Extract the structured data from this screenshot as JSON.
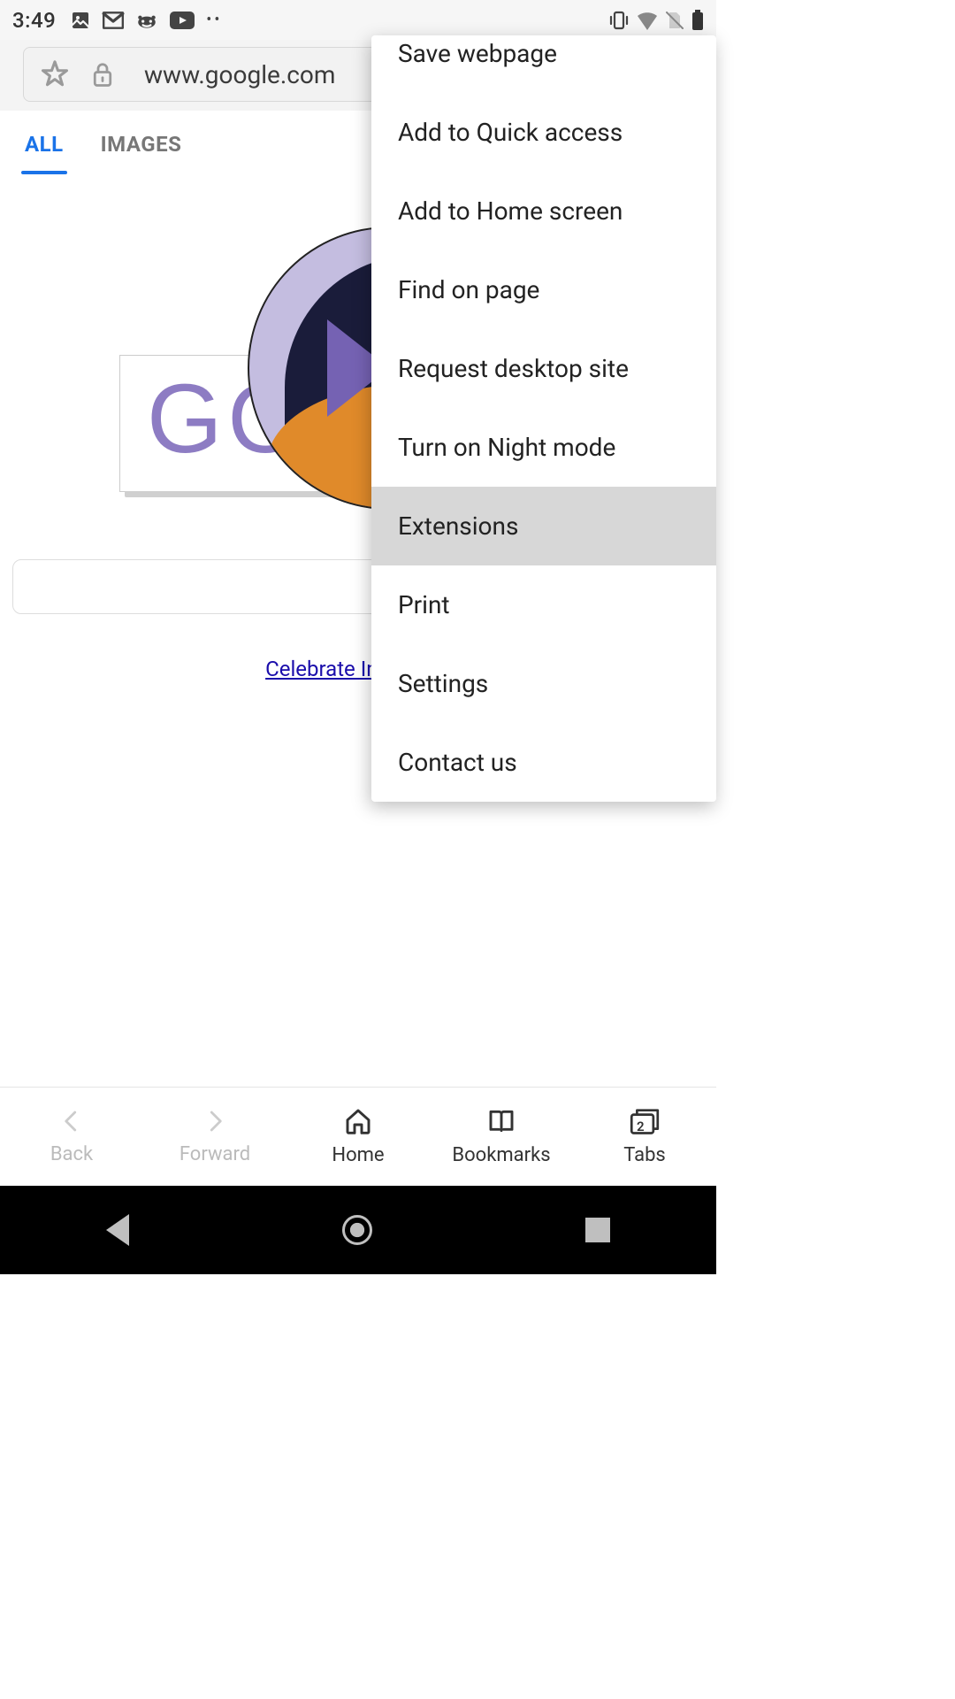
{
  "status": {
    "time": "3:49"
  },
  "addr": {
    "url": "www.google.com"
  },
  "tabs": {
    "all": "ALL",
    "images": "IMAGES"
  },
  "doodle": {
    "go": "GO",
    "link": "Celebrate Internatio"
  },
  "menu": {
    "save": "Save webpage",
    "quick": "Add to Quick access",
    "home": "Add to Home screen",
    "find": "Find on page",
    "desktop": "Request desktop site",
    "night": "Turn on Night mode",
    "ext": "Extensions",
    "print": "Print",
    "settings": "Settings",
    "contact": "Contact us"
  },
  "toolbar": {
    "back": "Back",
    "forward": "Forward",
    "home": "Home",
    "bookmarks": "Bookmarks",
    "tabs": "Tabs",
    "tab_count": "2"
  }
}
